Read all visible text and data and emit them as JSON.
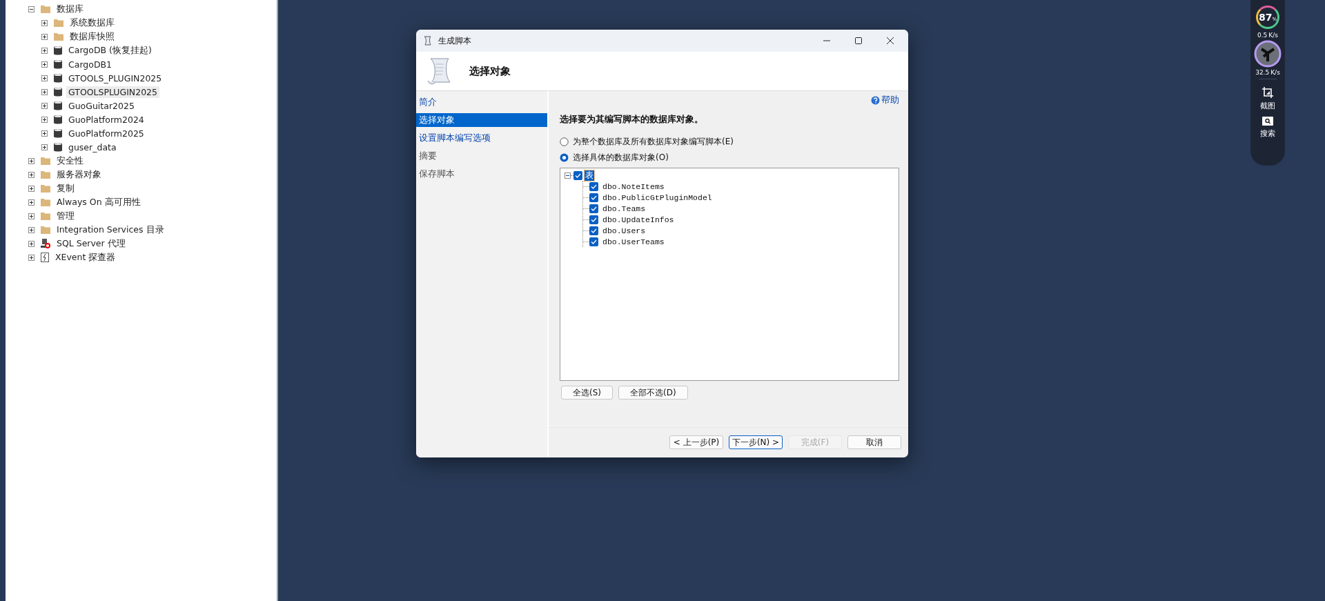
{
  "explorer": {
    "items": [
      {
        "label": "数据库",
        "kind": "folder",
        "expanded": true,
        "selected": false,
        "children": [
          {
            "label": "系统数据库",
            "kind": "folder",
            "expanded": false,
            "selected": false
          },
          {
            "label": "数据库快照",
            "kind": "folder",
            "expanded": false,
            "selected": false
          },
          {
            "label": "CargoDB (恢复挂起)",
            "kind": "database",
            "expanded": false,
            "selected": false
          },
          {
            "label": "CargoDB1",
            "kind": "database",
            "expanded": false,
            "selected": false
          },
          {
            "label": "GTOOLS_PLUGIN2025",
            "kind": "database",
            "expanded": false,
            "selected": false
          },
          {
            "label": "GTOOLSPLUGIN2025",
            "kind": "database",
            "expanded": false,
            "selected": true
          },
          {
            "label": "GuoGuitar2025",
            "kind": "database",
            "expanded": false,
            "selected": false
          },
          {
            "label": "GuoPlatform2024",
            "kind": "database",
            "expanded": false,
            "selected": false
          },
          {
            "label": "GuoPlatform2025",
            "kind": "database",
            "expanded": false,
            "selected": false
          },
          {
            "label": "guser_data",
            "kind": "database",
            "expanded": false,
            "selected": false
          }
        ]
      },
      {
        "label": "安全性",
        "kind": "folder",
        "expanded": false,
        "selected": false
      },
      {
        "label": "服务器对象",
        "kind": "folder",
        "expanded": false,
        "selected": false
      },
      {
        "label": "复制",
        "kind": "folder",
        "expanded": false,
        "selected": false
      },
      {
        "label": "Always On 高可用性",
        "kind": "folder",
        "expanded": false,
        "selected": false
      },
      {
        "label": "管理",
        "kind": "folder",
        "expanded": false,
        "selected": false
      },
      {
        "label": "Integration Services 目录",
        "kind": "folder",
        "expanded": false,
        "selected": false
      },
      {
        "label": "SQL Server 代理",
        "kind": "agent",
        "expanded": false,
        "selected": false
      },
      {
        "label": "XEvent 探查器",
        "kind": "xevent",
        "expanded": false,
        "selected": false
      }
    ]
  },
  "dialog": {
    "title": "生成脚本",
    "header": "选择对象",
    "nav": [
      {
        "label": "简介",
        "selected": false,
        "disabled": false
      },
      {
        "label": "选择对象",
        "selected": true,
        "disabled": false
      },
      {
        "label": "设置脚本编写选项",
        "selected": false,
        "disabled": false
      },
      {
        "label": "摘要",
        "selected": false,
        "disabled": true
      },
      {
        "label": "保存脚本",
        "selected": false,
        "disabled": true
      }
    ],
    "help": "帮助",
    "heading": "选择要为其编写脚本的数据库对象。",
    "options": [
      {
        "label": "为整个数据库及所有数据库对象编写脚本(E)",
        "selected": false
      },
      {
        "label": "选择具体的数据库对象(O)",
        "selected": true
      }
    ],
    "objects": {
      "label": "表",
      "checked": true,
      "expanded": true,
      "children": [
        {
          "label": "dbo.NoteItems",
          "checked": true
        },
        {
          "label": "dbo.PublicGtPluginModel",
          "checked": true
        },
        {
          "label": "dbo.Teams",
          "checked": true
        },
        {
          "label": "dbo.UpdateInfos",
          "checked": true
        },
        {
          "label": "dbo.Users",
          "checked": true
        },
        {
          "label": "dbo.UserTeams",
          "checked": true
        }
      ]
    },
    "select_buttons": [
      "全选(S)",
      "全部不选(D)"
    ],
    "footer_buttons": [
      {
        "label": "< 上一步(P)",
        "disabled": false,
        "focused": false
      },
      {
        "label": "下一步(N) >",
        "disabled": false,
        "focused": true
      },
      {
        "label": "完成(F)",
        "disabled": true,
        "focused": false
      },
      {
        "label": "取消",
        "disabled": false,
        "focused": false
      }
    ]
  },
  "widget": {
    "cpu": "87",
    "cpu_unit": "%",
    "upload": "0.5",
    "upload_unit": "K/s",
    "download": "32.5",
    "download_unit": "K/s",
    "tools": [
      {
        "label": "截图",
        "kind": "crop"
      },
      {
        "label": "搜索",
        "kind": "search"
      }
    ]
  }
}
